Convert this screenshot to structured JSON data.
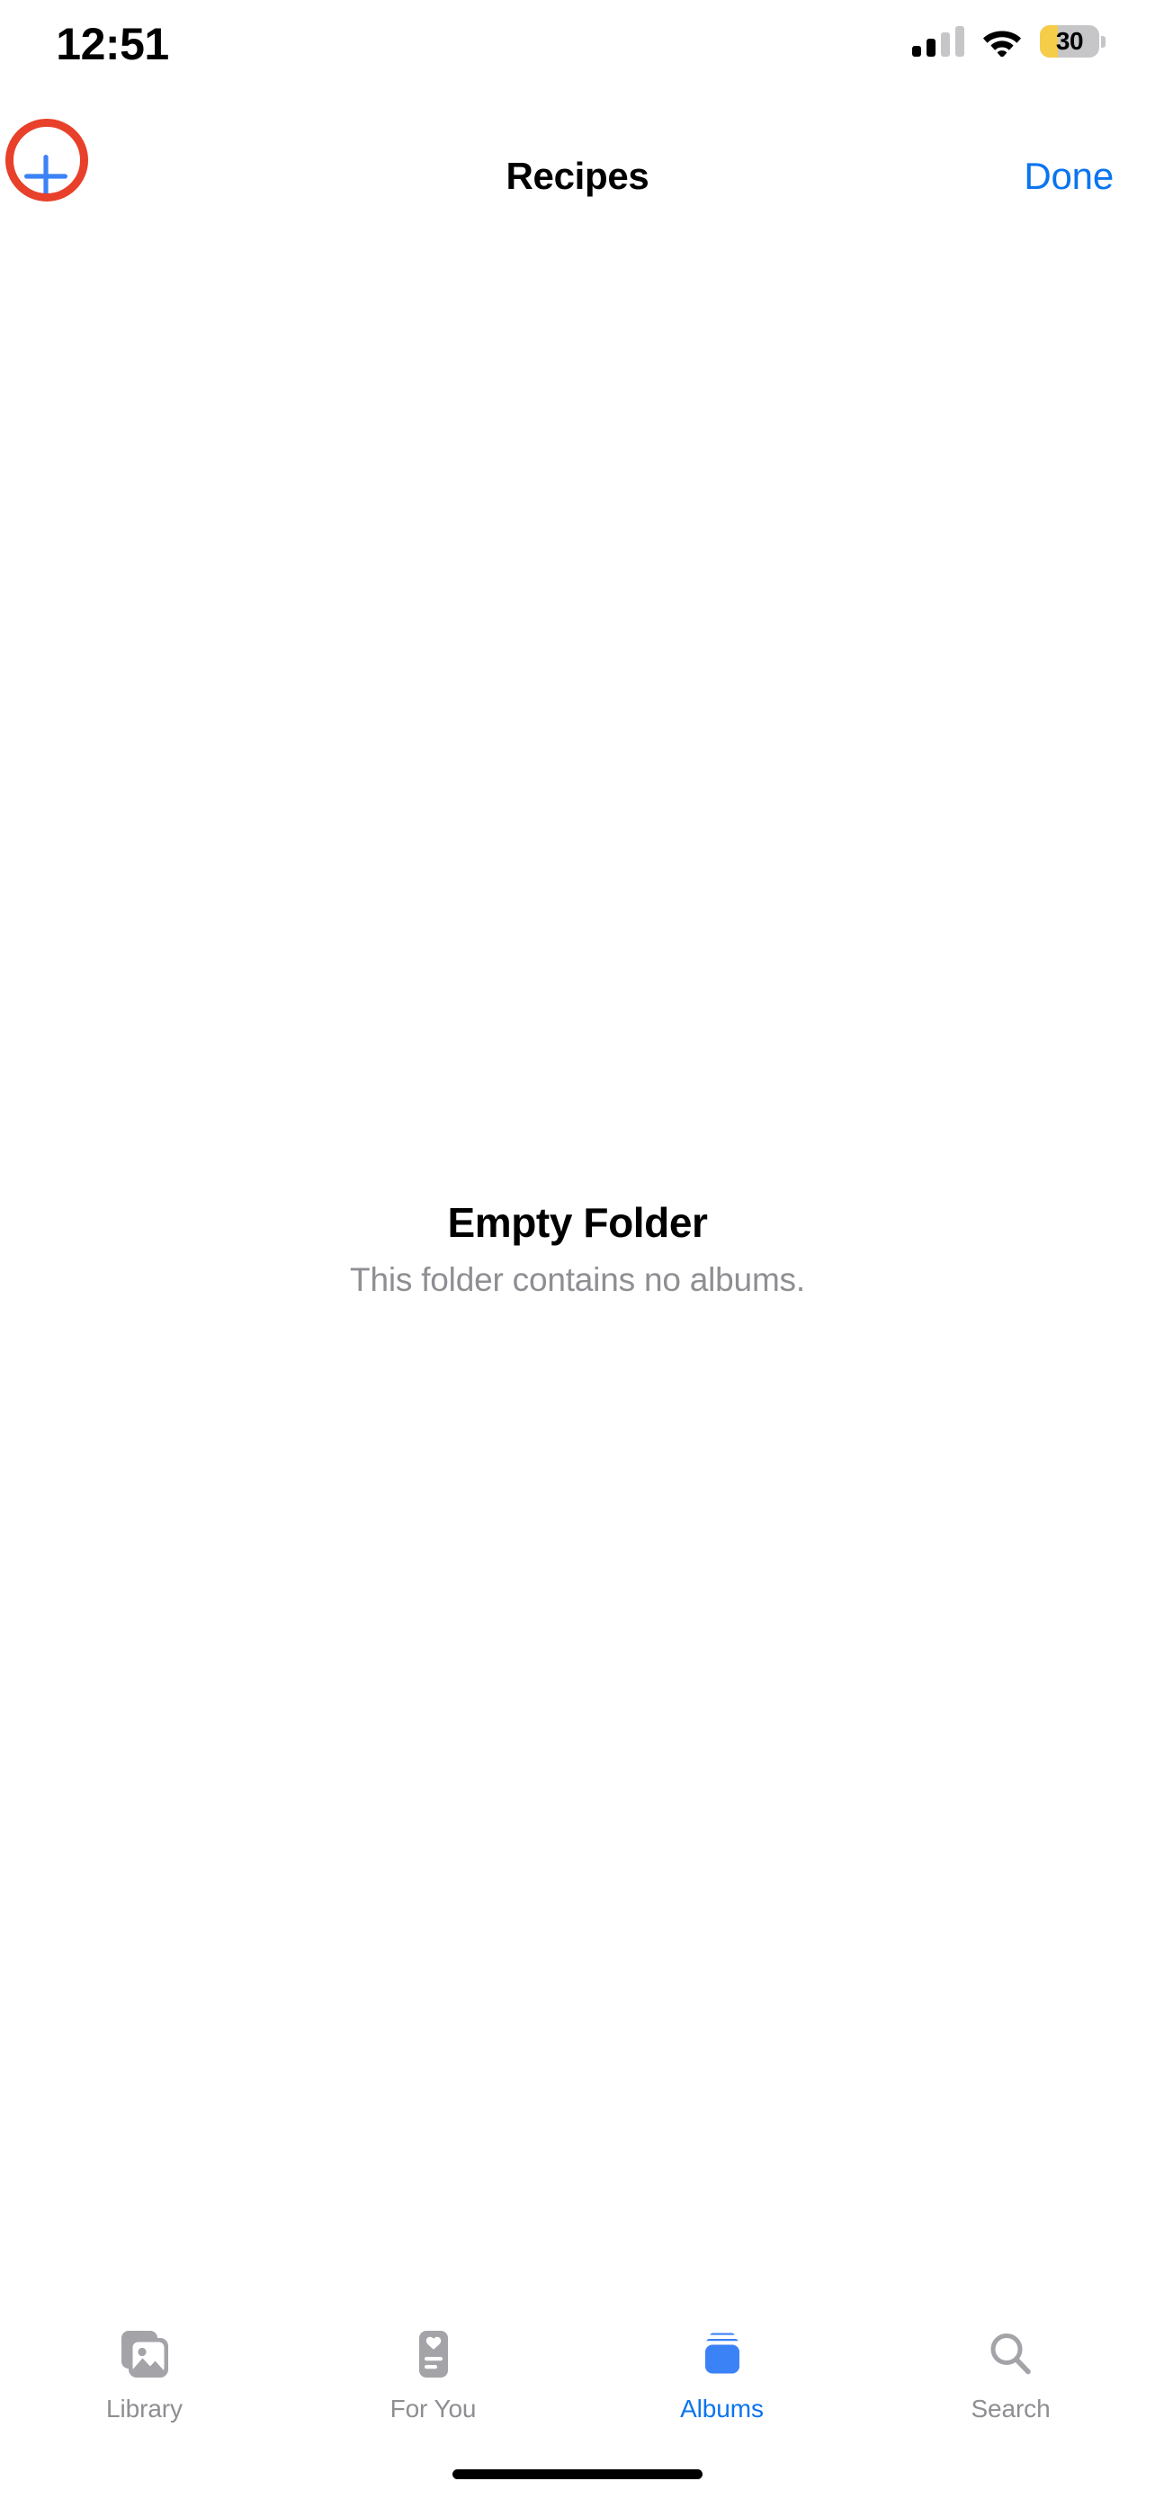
{
  "status_bar": {
    "time": "12:51",
    "cellular_icon": "signal-bars-icon",
    "cellular_bars_filled": 2,
    "cellular_bars_total": 4,
    "wifi_icon": "wifi-icon",
    "battery_icon": "battery-icon",
    "battery_level": "30",
    "battery_percent": 30,
    "battery_color": "#f5cd48",
    "battery_track_color": "#c6c6c8"
  },
  "nav_bar": {
    "add_icon": "plus-icon",
    "title": "Recipes",
    "done_label": "Done",
    "accent_color": "#0b74ef"
  },
  "annotation": {
    "shape": "circle",
    "color": "#e8402a",
    "target": "add-album-button"
  },
  "empty_state": {
    "title": "Empty Folder",
    "subtitle": "This folder contains no albums."
  },
  "tab_bar": {
    "active_color": "#0b74ef",
    "inactive_color": "#8e8e93",
    "items": [
      {
        "label": "Library",
        "icon": "photo-stack-icon",
        "active": false
      },
      {
        "label": "For You",
        "icon": "for-you-card-icon",
        "active": false
      },
      {
        "label": "Albums",
        "icon": "albums-stack-icon",
        "active": true
      },
      {
        "label": "Search",
        "icon": "magnifier-icon",
        "active": false
      }
    ]
  },
  "home_indicator": {
    "present": true
  }
}
